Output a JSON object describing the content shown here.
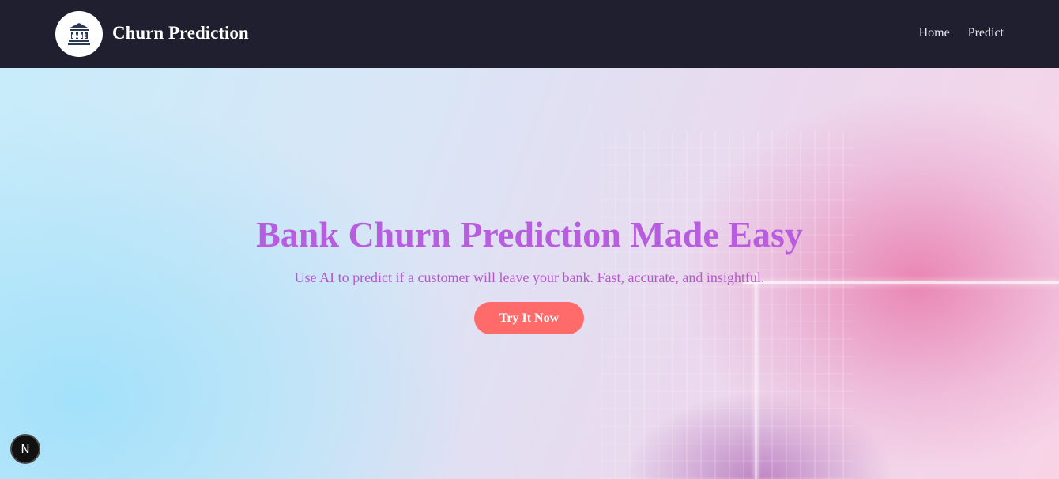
{
  "header": {
    "brand_title": "Churn Prediction",
    "logo_icon": "bank-building-icon",
    "logo_text": "BANK",
    "nav": [
      {
        "label": "Home"
      },
      {
        "label": "Predict"
      }
    ]
  },
  "hero": {
    "title": "Bank Churn Prediction Made Easy",
    "subtitle": "Use AI to predict if a customer will leave your bank. Fast, accurate, and insightful.",
    "cta_label": "Try It Now"
  },
  "dev_badge": {
    "letter": "N",
    "icon": "nextjs-dev-indicator-icon"
  },
  "colors": {
    "navbar_bg": "#1f1f30",
    "title_color": "#b95de0",
    "subtitle_color": "#b459cc",
    "cta_bg": "#ff6b6b"
  }
}
